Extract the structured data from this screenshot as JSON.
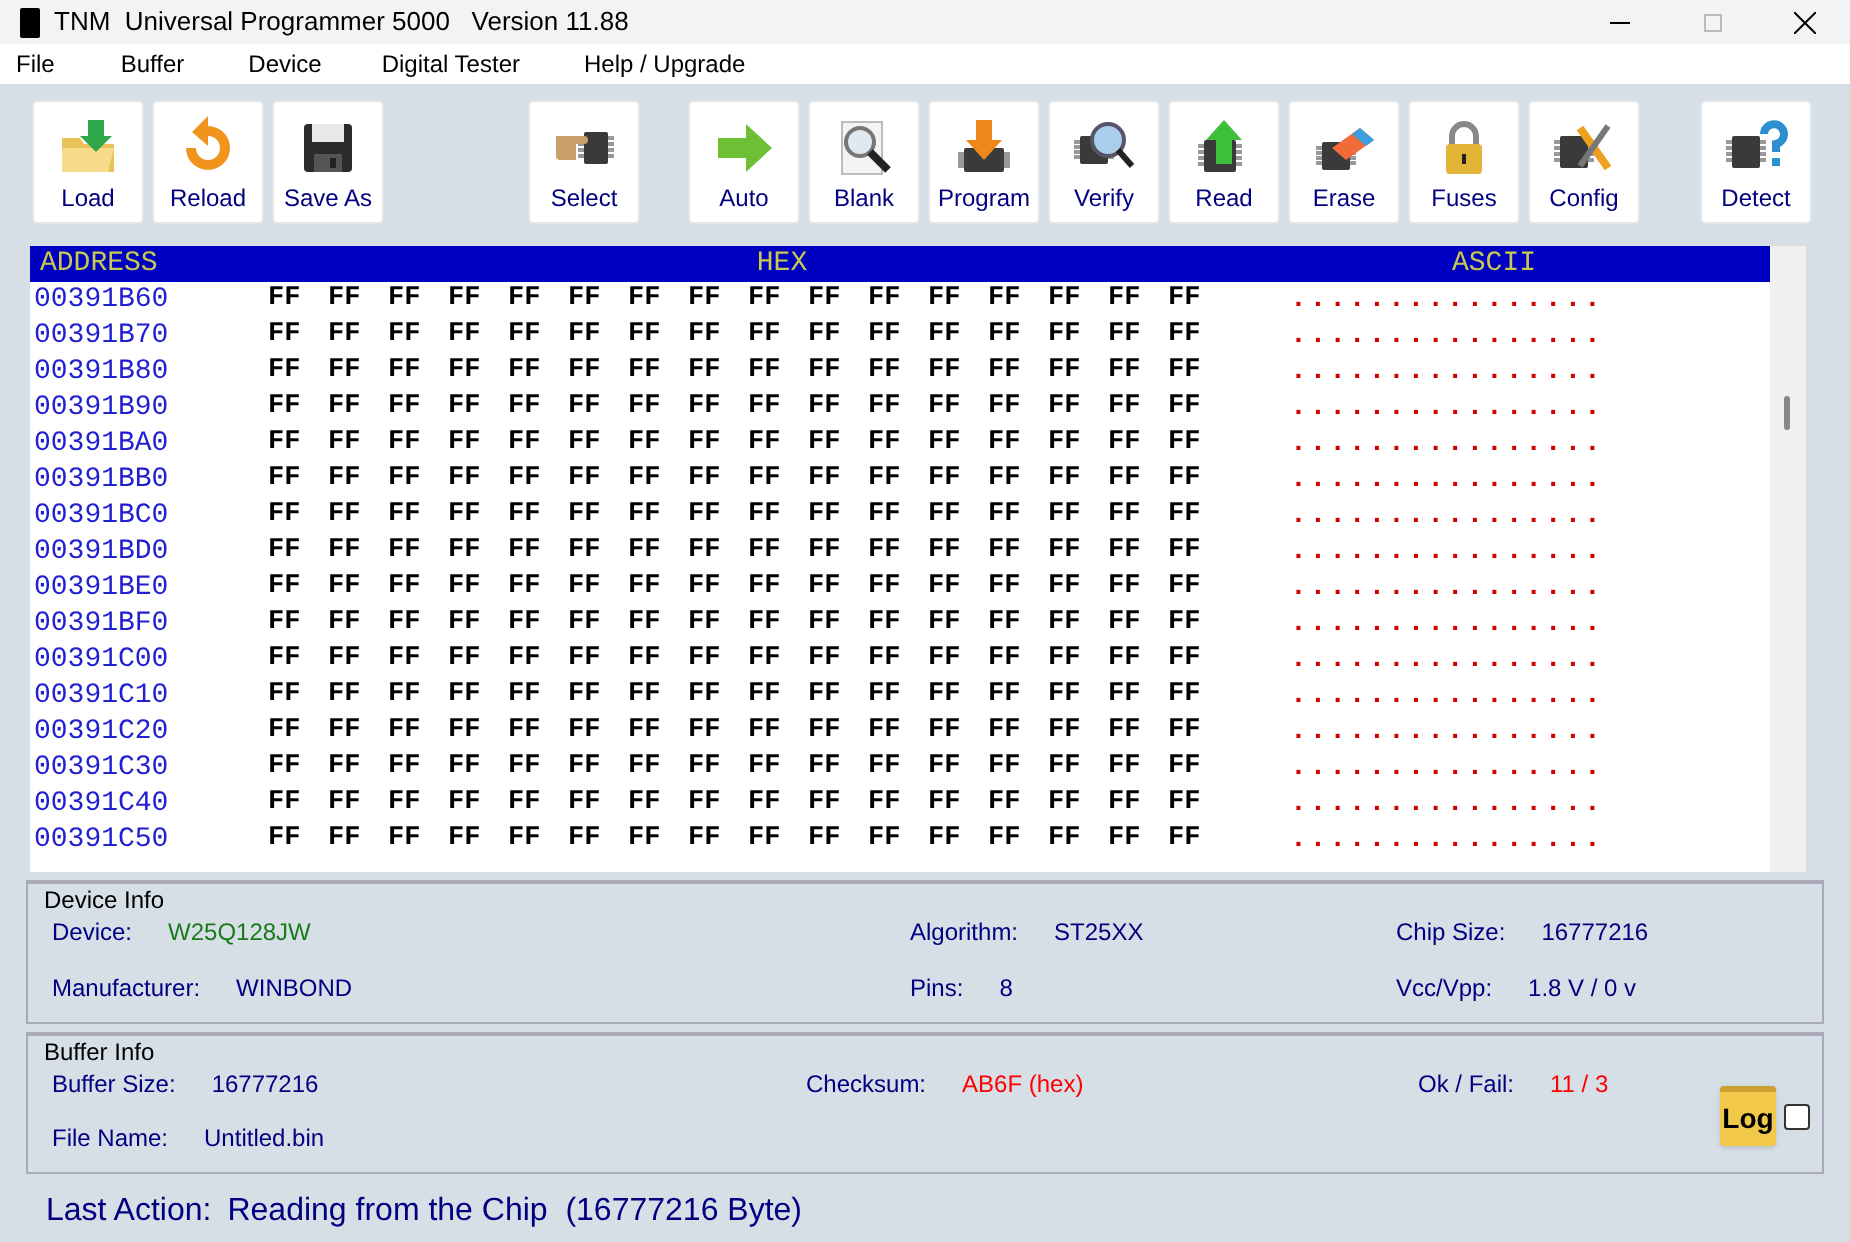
{
  "window": {
    "title": "TNM  Universal Programmer 5000   Version 11.88"
  },
  "menu": [
    "File",
    "Buffer",
    "Device",
    "Digital Tester",
    "Help / Upgrade"
  ],
  "toolbar": [
    [
      {
        "label": "Load"
      },
      {
        "label": "Reload"
      },
      {
        "label": "Save As"
      }
    ],
    [
      {
        "label": "Select"
      }
    ],
    [
      {
        "label": "Auto"
      },
      {
        "label": "Blank"
      },
      {
        "label": "Program"
      },
      {
        "label": "Verify"
      },
      {
        "label": "Read"
      },
      {
        "label": "Erase"
      },
      {
        "label": "Fuses"
      },
      {
        "label": "Config"
      }
    ],
    [
      {
        "label": "Detect"
      }
    ]
  ],
  "hex_view": {
    "columns": [
      "ADDRESS",
      "HEX",
      "ASCII"
    ],
    "rows": [
      {
        "address": "00391B60",
        "hex": "FF FF FF FF FF FF FF FF FF FF FF FF FF FF FF FF",
        "ascii": "................"
      },
      {
        "address": "00391B70",
        "hex": "FF FF FF FF FF FF FF FF FF FF FF FF FF FF FF FF",
        "ascii": "................"
      },
      {
        "address": "00391B80",
        "hex": "FF FF FF FF FF FF FF FF FF FF FF FF FF FF FF FF",
        "ascii": "................"
      },
      {
        "address": "00391B90",
        "hex": "FF FF FF FF FF FF FF FF FF FF FF FF FF FF FF FF",
        "ascii": "................"
      },
      {
        "address": "00391BA0",
        "hex": "FF FF FF FF FF FF FF FF FF FF FF FF FF FF FF FF",
        "ascii": "................"
      },
      {
        "address": "00391BB0",
        "hex": "FF FF FF FF FF FF FF FF FF FF FF FF FF FF FF FF",
        "ascii": "................"
      },
      {
        "address": "00391BC0",
        "hex": "FF FF FF FF FF FF FF FF FF FF FF FF FF FF FF FF",
        "ascii": "................"
      },
      {
        "address": "00391BD0",
        "hex": "FF FF FF FF FF FF FF FF FF FF FF FF FF FF FF FF",
        "ascii": "................"
      },
      {
        "address": "00391BE0",
        "hex": "FF FF FF FF FF FF FF FF FF FF FF FF FF FF FF FF",
        "ascii": "................"
      },
      {
        "address": "00391BF0",
        "hex": "FF FF FF FF FF FF FF FF FF FF FF FF FF FF FF FF",
        "ascii": "................"
      },
      {
        "address": "00391C00",
        "hex": "FF FF FF FF FF FF FF FF FF FF FF FF FF FF FF FF",
        "ascii": "................"
      },
      {
        "address": "00391C10",
        "hex": "FF FF FF FF FF FF FF FF FF FF FF FF FF FF FF FF",
        "ascii": "................"
      },
      {
        "address": "00391C20",
        "hex": "FF FF FF FF FF FF FF FF FF FF FF FF FF FF FF FF",
        "ascii": "................"
      },
      {
        "address": "00391C30",
        "hex": "FF FF FF FF FF FF FF FF FF FF FF FF FF FF FF FF",
        "ascii": "................"
      },
      {
        "address": "00391C40",
        "hex": "FF FF FF FF FF FF FF FF FF FF FF FF FF FF FF FF",
        "ascii": "................"
      },
      {
        "address": "00391C50",
        "hex": "FF FF FF FF FF FF FF FF FF FF FF FF FF FF FF FF",
        "ascii": "................"
      }
    ]
  },
  "device_info": {
    "title": "Device Info",
    "fields": [
      {
        "label": "Device:",
        "value": "W25Q128JW",
        "color": "#1a7a1a"
      },
      {
        "label": "Algorithm:",
        "value": "ST25XX",
        "color": "#000080"
      },
      {
        "label": "Chip Size:",
        "value": "16777216",
        "color": "#000080"
      },
      {
        "label": "Manufacturer:",
        "value": "WINBOND",
        "color": "#000080"
      },
      {
        "label": "Pins:",
        "value": "8",
        "color": "#000080"
      },
      {
        "label": "Vcc/Vpp:",
        "value": "1.8 V / 0 v",
        "color": "#000080"
      }
    ]
  },
  "buffer_info": {
    "title": "Buffer Info",
    "fields": [
      {
        "label": "Buffer Size:",
        "value": "16777216",
        "color": "#000080"
      },
      {
        "label": "Checksum:",
        "value": "AB6F (hex)",
        "color": "#ff0000"
      },
      {
        "label": "Ok / Fail:",
        "value": "11 / 3",
        "color": "#ff0000"
      },
      {
        "label": "File Name:",
        "value": "Untitled.bin",
        "color": "#000080"
      }
    ],
    "log_label": "Log",
    "log_checkbox": {
      "checked": false
    }
  },
  "status": {
    "label": "Last Action:",
    "value": "Reading from the Chip  (16777216 Byte)"
  }
}
